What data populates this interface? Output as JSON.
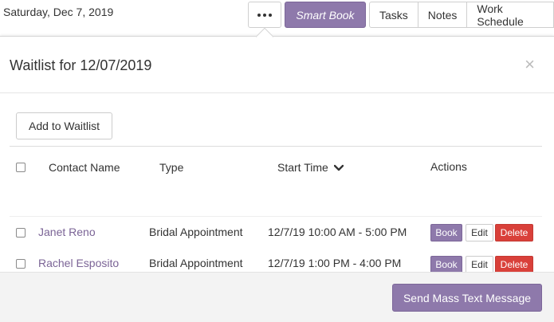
{
  "topbar": {
    "date": "Saturday, Dec 7, 2019",
    "more_icon": "ellipsis-icon",
    "smart_book_label": "Smart Book",
    "tabs": [
      {
        "label": "Tasks"
      },
      {
        "label": "Notes"
      },
      {
        "label": "Work Schedule"
      }
    ]
  },
  "modal": {
    "title": "Waitlist for 12/07/2019",
    "close_label": "×",
    "add_button_label": "Add to Waitlist",
    "table": {
      "headers": {
        "contact": "Contact Name",
        "type": "Type",
        "start": "Start Time",
        "actions": "Actions"
      },
      "sort_icon": "chevron-down-icon",
      "rows": [
        {
          "contact": "Janet Reno",
          "type": "Bridal Appointment",
          "time": "12/7/19 10:00 AM - 5:00 PM",
          "book": "Book",
          "edit": "Edit",
          "delete": "Delete"
        },
        {
          "contact": "Rachel Esposito",
          "type": "Bridal Appointment",
          "time": "12/7/19 1:00 PM - 4:00 PM",
          "book": "Book",
          "edit": "Edit",
          "delete": "Delete"
        }
      ]
    },
    "footer_button_label": "Send Mass Text Message"
  },
  "colors": {
    "brand_purple": "#8e79ab",
    "link_purple": "#7b6496",
    "danger_red": "#d9403a"
  }
}
